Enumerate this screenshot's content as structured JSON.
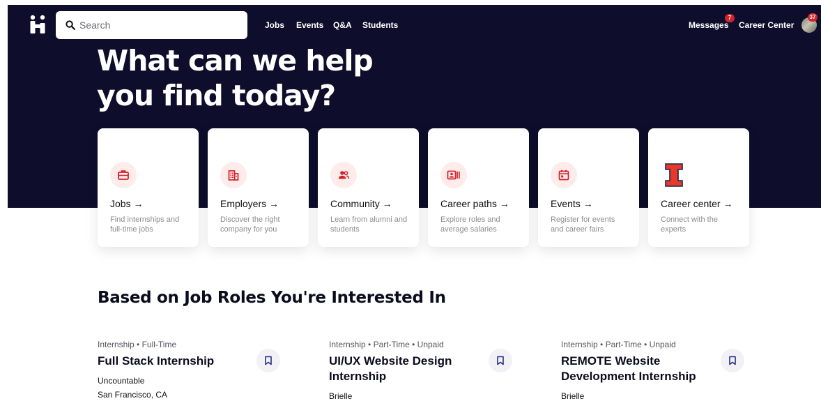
{
  "search": {
    "placeholder": "Search"
  },
  "nav": {
    "jobs": "Jobs",
    "events": "Events",
    "qa": "Q&A",
    "students": "Students",
    "messages": "Messages",
    "messages_badge": "7",
    "career_center": "Career Center",
    "profile_badge": "37"
  },
  "hero": {
    "headline_line1": "What can we help",
    "headline_line2": "you find today?"
  },
  "cards": [
    {
      "title": "Jobs →",
      "desc": "Find internships and full-time jobs",
      "icon": "briefcase-icon"
    },
    {
      "title": "Employers →",
      "desc": "Discover the right company for you",
      "icon": "building-icon"
    },
    {
      "title": "Community →",
      "desc": "Learn from alumni and students",
      "icon": "people-icon"
    },
    {
      "title": "Career paths →",
      "desc": "Explore roles and average salaries",
      "icon": "id-card-icon"
    },
    {
      "title": "Events →",
      "desc": "Register for events and career fairs",
      "icon": "calendar-icon"
    },
    {
      "title": "Career center →",
      "desc": "Connect with the experts",
      "icon": "block-i-logo-icon"
    }
  ],
  "section": {
    "title": "Based on Job Roles You're Interested In"
  },
  "jobs": [
    {
      "meta": "Internship • Full-Time",
      "title": "Full Stack Internship",
      "company": "Uncountable",
      "location": "San Francisco, CA"
    },
    {
      "meta": "Internship • Part-Time • Unpaid",
      "title": "UI/UX Website Design Internship",
      "company": "Brielle",
      "location": ""
    },
    {
      "meta": "Internship • Part-Time • Unpaid",
      "title": "REMOTE Website Development Internship",
      "company": "Brielle",
      "location": ""
    }
  ],
  "colors": {
    "navy": "#0e0e2c",
    "accent_red": "#d3222a",
    "icon_bg": "#fdecea",
    "illinois_red": "#e8372b"
  }
}
